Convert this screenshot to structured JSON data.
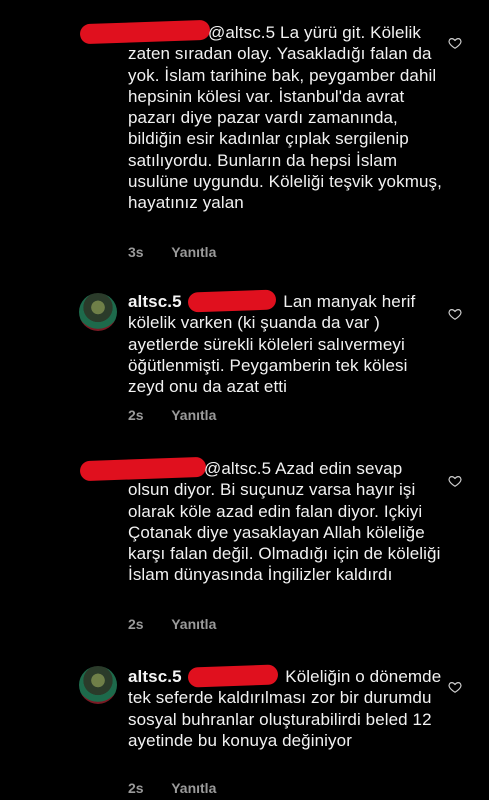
{
  "comments": [
    {
      "username": "",
      "mention": "@altsc.5",
      "text": "La yürü git. Kölelik zaten sıradan olay. Yasakladığı falan da yok. İslam tarihine bak, peygamber dahil hepsinin kölesi var. İstanbul'da avrat pazarı diye pazar vardı zamanında, bildiğin esir kadınlar çıplak sergilenip satılıyordu. Bunların da hepsi İslam usulüne uygundu. Köleliği teşvik yokmuş, hayatınız yalan",
      "time": "3s",
      "reply_label": "Yanıtla"
    },
    {
      "username": "altsc.5",
      "mention": "",
      "text": "Lan manyak herif kölelik varken (ki şuanda da var ) ayetlerde sürekli köleleri salıvermeyi öğütlenmişti. Peygamberin tek kölesi zeyd onu da azat etti",
      "time": "2s",
      "reply_label": "Yanıtla"
    },
    {
      "username": "",
      "mention": "@altsc.5",
      "text": "Azad edin sevap olsun diyor. Bi suçunuz varsa hayır işi olarak köle azad edin falan diyor. Içkiyi Çotanak diye yasaklayan Allah köleliğe karşı falan değil. Olmadığı için de köleliği İslam dünyasında İngilizler kaldırdı",
      "time": "2s",
      "reply_label": "Yanıtla"
    },
    {
      "username": "altsc.5",
      "mention": "",
      "text": "Köleliğin o dönemde tek seferde kaldırılması zor bir durumdu sosyal buhranlar oluşturabilirdi beled 12 ayetinde bu konuya değiniyor",
      "time": "2s",
      "reply_label": "Yanıtla"
    }
  ],
  "icons": {
    "like": "heart-outline-icon",
    "avatar": "user-avatar"
  },
  "colors": {
    "background": "#000000",
    "text": "#f2f2f2",
    "meta": "#9a9a9a",
    "redaction": "#e0101e"
  }
}
